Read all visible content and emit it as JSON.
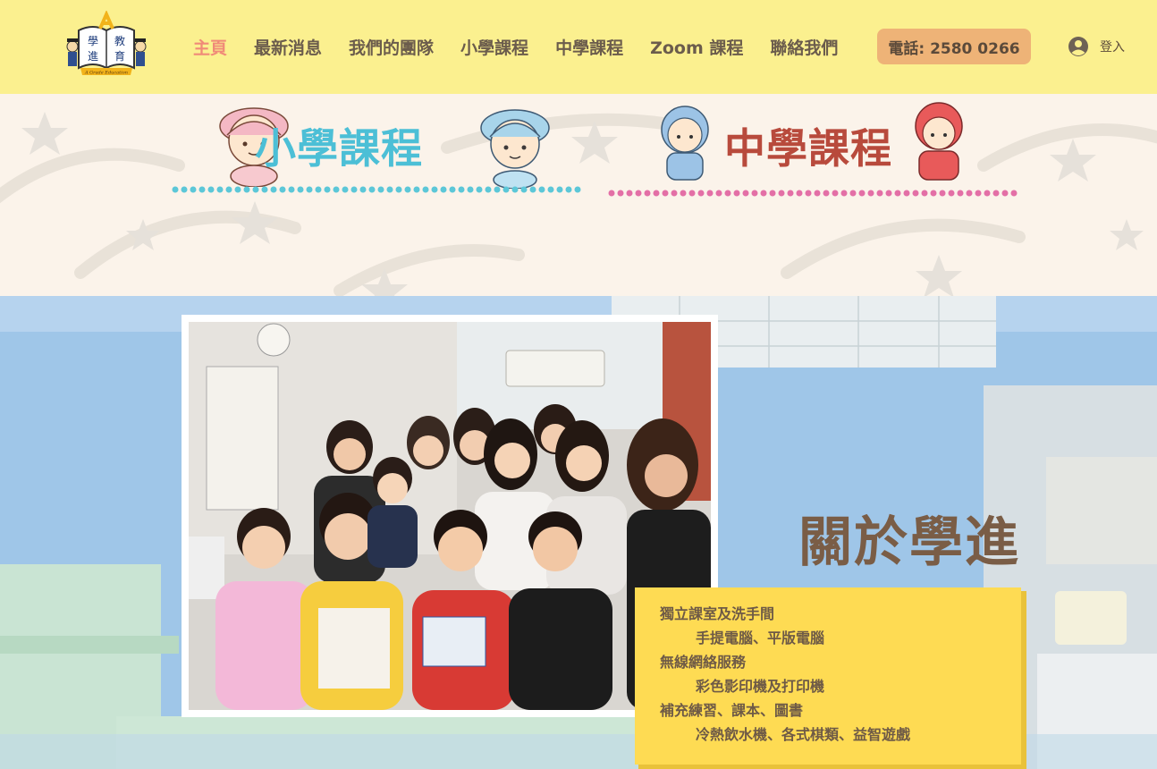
{
  "header": {
    "logo": {
      "text_chars": [
        "學",
        "教",
        "進",
        "育"
      ],
      "letter": "A",
      "tagline": "A Grade Education"
    },
    "nav_items": [
      {
        "label": "主頁",
        "active": true
      },
      {
        "label": "最新消息",
        "active": false
      },
      {
        "label": "我們的團隊",
        "active": false
      },
      {
        "label": "小學課程",
        "active": false
      },
      {
        "label": "中學課程",
        "active": false
      },
      {
        "label": "Zoom 課程",
        "active": false
      },
      {
        "label": "聯絡我們",
        "active": false
      }
    ],
    "phone_button": "電話: 2580 0266",
    "login": {
      "icon": "user-avatar-icon",
      "label": "登入"
    }
  },
  "banner": {
    "primary_course": {
      "title": "小學課程",
      "color": "#4cbfd6",
      "dot_color": "#5cc7d8"
    },
    "secondary_course": {
      "title": "中學課程",
      "color": "#b84a3c",
      "dot_color": "#e36fa6"
    }
  },
  "about": {
    "title": "關於學進",
    "facilities": [
      {
        "text": "獨立課室及洗手間",
        "indent": false
      },
      {
        "text": "手提電腦、平版電腦",
        "indent": true
      },
      {
        "text": "無線網絡服務",
        "indent": false
      },
      {
        "text": "彩色影印機及打印機",
        "indent": true
      },
      {
        "text": "補充練習、課本、圖書",
        "indent": false
      },
      {
        "text": "冷熱飲水機、各式棋類、益智遊戲",
        "indent": true
      }
    ]
  },
  "colors": {
    "header_bg": "#fbf08f",
    "nav_text": "#6b5c4c",
    "nav_active": "#f08a78",
    "phone_bg": "#eeb377",
    "facilities_bg": "#fedb53",
    "about_title": "#7a5d46"
  }
}
